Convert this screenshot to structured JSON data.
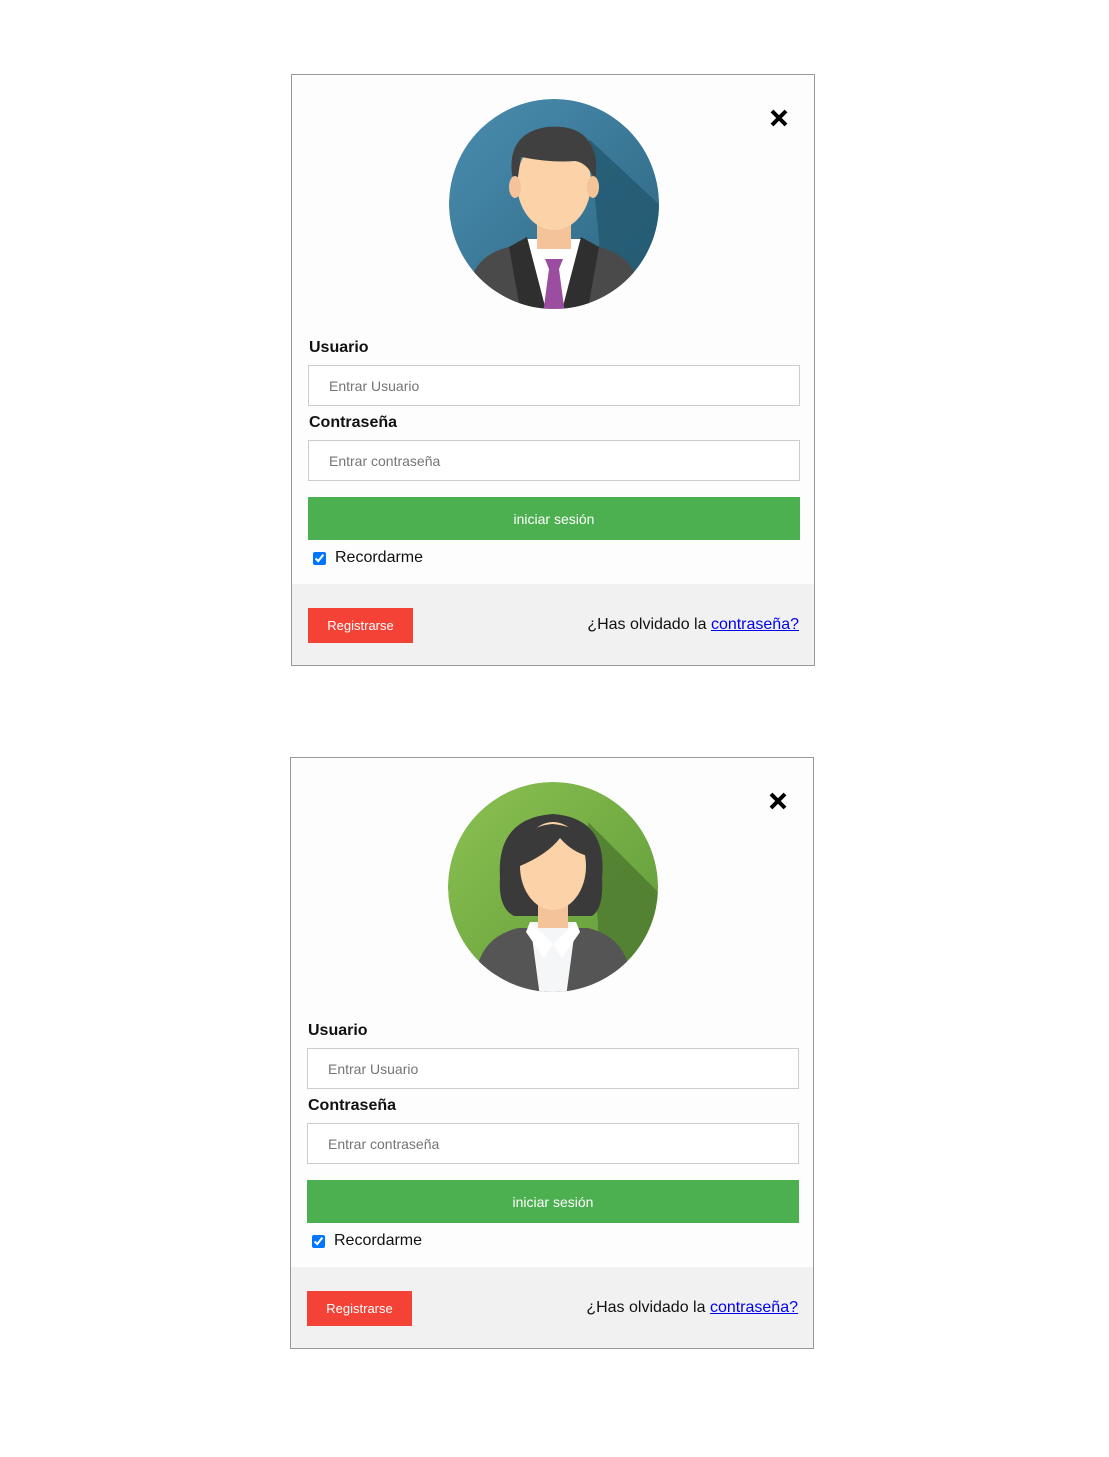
{
  "forms": [
    {
      "avatar": {
        "icon": "male-avatar-icon",
        "bg_color": "#3f7e9c"
      },
      "close_icon": "close-icon",
      "username": {
        "label": "Usuario",
        "placeholder": "Entrar Usuario",
        "value": ""
      },
      "password": {
        "label": "Contraseña",
        "placeholder": "Entrar contraseña",
        "value": ""
      },
      "login_label": "iniciar sesión",
      "remember": {
        "label": "Recordarme",
        "checked": true
      },
      "register_label": "Registrarse",
      "forgot_text": "¿Has olvidado la ",
      "forgot_link": "contraseña?"
    },
    {
      "avatar": {
        "icon": "female-avatar-icon",
        "bg_color": "#7ab648"
      },
      "close_icon": "close-icon",
      "username": {
        "label": "Usuario",
        "placeholder": "Entrar Usuario",
        "value": ""
      },
      "password": {
        "label": "Contraseña",
        "placeholder": "Entrar contraseña",
        "value": ""
      },
      "login_label": "iniciar sesión",
      "remember": {
        "label": "Recordarme",
        "checked": true
      },
      "register_label": "Registrarse",
      "forgot_text": "¿Has olvidado la ",
      "forgot_link": "contraseña?"
    }
  ],
  "colors": {
    "login_button": "#4caf50",
    "register_button": "#f44336",
    "footer_bg": "#f1f1f1",
    "link": "#0000ee"
  }
}
